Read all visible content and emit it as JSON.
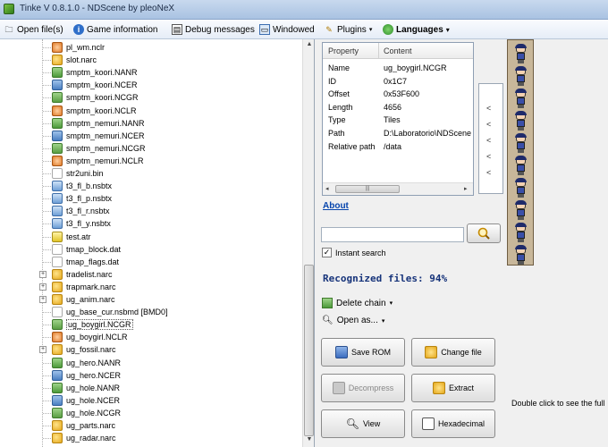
{
  "window": {
    "title": "Tinke V 0.8.1.0 - NDScene by pleoNeX"
  },
  "toolbar": {
    "open_files": "Open file(s)",
    "game_information": "Game information",
    "debug_messages": "Debug messages",
    "windowed": "Windowed",
    "plugins": "Plugins",
    "languages": "Languages"
  },
  "tree": {
    "items": [
      {
        "label": "pl_wm.nclr",
        "type": "nclr"
      },
      {
        "label": "slot.narc",
        "type": "narc"
      },
      {
        "label": "smptm_koori.NANR",
        "type": "nanr"
      },
      {
        "label": "smptm_koori.NCER",
        "type": "ncer"
      },
      {
        "label": "smptm_koori.NCGR",
        "type": "ncgr"
      },
      {
        "label": "smptm_koori.NCLR",
        "type": "nclr"
      },
      {
        "label": "smptm_nemuri.NANR",
        "type": "nanr"
      },
      {
        "label": "smptm_nemuri.NCER",
        "type": "ncer"
      },
      {
        "label": "smptm_nemuri.NCGR",
        "type": "ncgr"
      },
      {
        "label": "smptm_nemuri.NCLR",
        "type": "nclr"
      },
      {
        "label": "str2uni.bin",
        "type": "file"
      },
      {
        "label": "t3_fl_b.nsbtx",
        "type": "nsbtx"
      },
      {
        "label": "t3_fl_p.nsbtx",
        "type": "nsbtx"
      },
      {
        "label": "t3_fl_r.nsbtx",
        "type": "nsbtx"
      },
      {
        "label": "t3_fl_y.nsbtx",
        "type": "nsbtx"
      },
      {
        "label": "test.atr",
        "type": "atr"
      },
      {
        "label": "tmap_block.dat",
        "type": "file"
      },
      {
        "label": "tmap_flags.dat",
        "type": "file"
      },
      {
        "label": "tradelist.narc",
        "type": "narc"
      },
      {
        "label": "trapmark.narc",
        "type": "narc"
      },
      {
        "label": "ug_anim.narc",
        "type": "narc"
      },
      {
        "label": "ug_base_cur.nsbmd [BMD0]",
        "type": "file"
      },
      {
        "label": "ug_boygirl.NCGR",
        "type": "ncgr"
      },
      {
        "label": "ug_boygirl.NCLR",
        "type": "nclr"
      },
      {
        "label": "ug_fossil.narc",
        "type": "narc"
      },
      {
        "label": "ug_hero.NANR",
        "type": "nanr"
      },
      {
        "label": "ug_hero.NCER",
        "type": "ncer"
      },
      {
        "label": "ug_hole.NANR",
        "type": "nanr"
      },
      {
        "label": "ug_hole.NCER",
        "type": "ncer"
      },
      {
        "label": "ug_hole.NCGR",
        "type": "ncgr"
      },
      {
        "label": "ug_parts.narc",
        "type": "narc"
      },
      {
        "label": "ug_radar.narc",
        "type": "narc"
      }
    ],
    "expandable_labels": [
      "tradelist.narc",
      "trapmark.narc",
      "ug_anim.narc",
      "ug_fossil.narc"
    ],
    "selected_label": "ug_boygirl.NCGR"
  },
  "properties": {
    "header_property": "Property",
    "header_content": "Content",
    "rows": [
      {
        "key": "Name",
        "value": "ug_boygirl.NCGR"
      },
      {
        "key": "ID",
        "value": "0x1C7"
      },
      {
        "key": "Offset",
        "value": "0x53F600"
      },
      {
        "key": "Length",
        "value": "4656"
      },
      {
        "key": "Type",
        "value": "Tiles"
      },
      {
        "key": "Path",
        "value": "D:\\Laboratorio\\NDScene"
      },
      {
        "key": "Relative path",
        "value": "/data"
      }
    ]
  },
  "arrows": [
    "<",
    "<",
    "<",
    "<",
    "<"
  ],
  "about_link": "About",
  "search": {
    "value": "",
    "instant_label": "Instant search",
    "instant_checked": true
  },
  "recognized": "Recognized files: 94%",
  "delete_chain": "Delete chain",
  "open_as": "Open as...",
  "buttons": {
    "save_rom": "Save ROM",
    "change_file": "Change file",
    "decompress": "Decompress",
    "extract": "Extract",
    "view": "View",
    "hexadecimal": "Hexadecimal"
  },
  "hint": "Double click to see the full",
  "colors": {
    "link": "#0645ad",
    "recognized": "#16337a",
    "sprite_bg": "#c8b79a"
  }
}
